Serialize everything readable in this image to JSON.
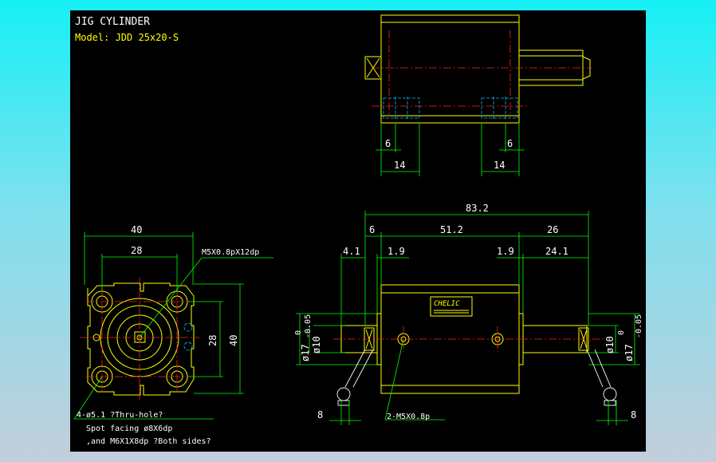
{
  "title": "JIG CYLINDER",
  "model": "Model:  JDD 25x20-S",
  "brand_label": "CHELIC",
  "top_view": {
    "dim_left_6": "6",
    "dim_right_6": "6",
    "dim_left_14": "14",
    "dim_right_14": "14"
  },
  "side_view": {
    "overall": "83.2",
    "seg_6": "6",
    "seg_51_2": "51.2",
    "seg_26": "26",
    "seg_4_1": "4.1",
    "seg_1_9_left": "1.9",
    "seg_1_9_right": "1.9",
    "seg_24_1": "24.1",
    "dia10_left": "ø10",
    "dia17_left": "ø17",
    "tol_left_top": "0",
    "tol_left_bottom": "-0.05",
    "dia10_right": "ø10",
    "dia17_right": "ø17",
    "tol_right_top": "0",
    "tol_right_bottom": "-0.05",
    "dim_8_left": "8",
    "dim_8_right": "8",
    "port_note": "2-M5X0.8p"
  },
  "end_view": {
    "dim_40_top": "40",
    "dim_28_top": "28",
    "dim_28_side": "28",
    "dim_40_side": "40",
    "thread_note": "M5X0.8pX12dp",
    "hole_note_1": "4-ø5.1 ?Thru-hole?",
    "hole_note_2": "Spot facing  ø8X6dp",
    "hole_note_3": ",and M6X1X8dp ?Both sides?"
  }
}
